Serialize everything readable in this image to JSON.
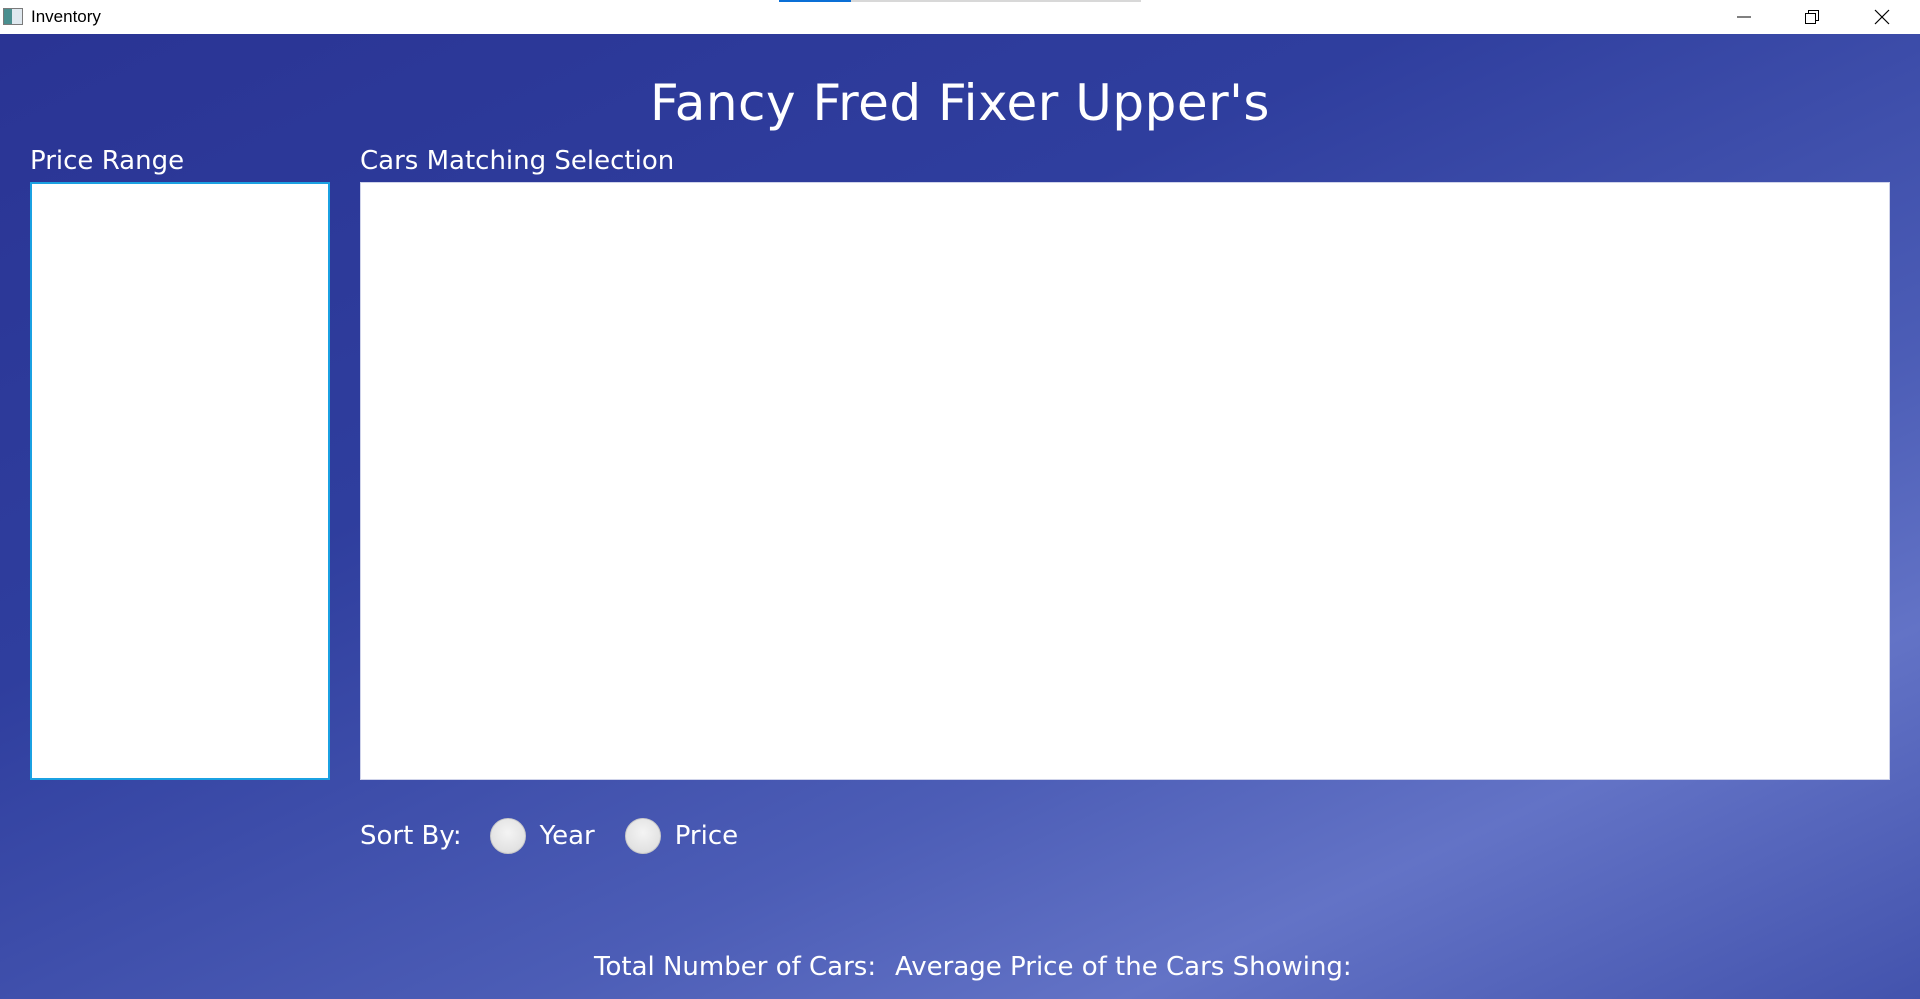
{
  "window": {
    "title": "Inventory",
    "progress_fraction": 0.2,
    "icons": {
      "app": "window-app-icon",
      "minimize": "minimize-icon",
      "maximize": "restore-icon",
      "close": "close-icon"
    }
  },
  "main": {
    "heading": "Fancy Fred Fixer Upper's",
    "price_range_label": "Price Range",
    "cars_label": "Cars Matching Selection",
    "price_range_items": [],
    "cars_items": []
  },
  "sort": {
    "label": "Sort By:",
    "options": [
      {
        "label": "Year",
        "checked": false
      },
      {
        "label": "Price",
        "checked": false
      }
    ]
  },
  "footer": {
    "total_label": "Total Number of Cars:",
    "average_label": "Average Price of the Cars Showing:"
  },
  "colors": {
    "gradient_dark": "#2a3494",
    "gradient_light": "#6373c6",
    "focus_border": "#1ba1e2",
    "text": "#ffffff"
  }
}
